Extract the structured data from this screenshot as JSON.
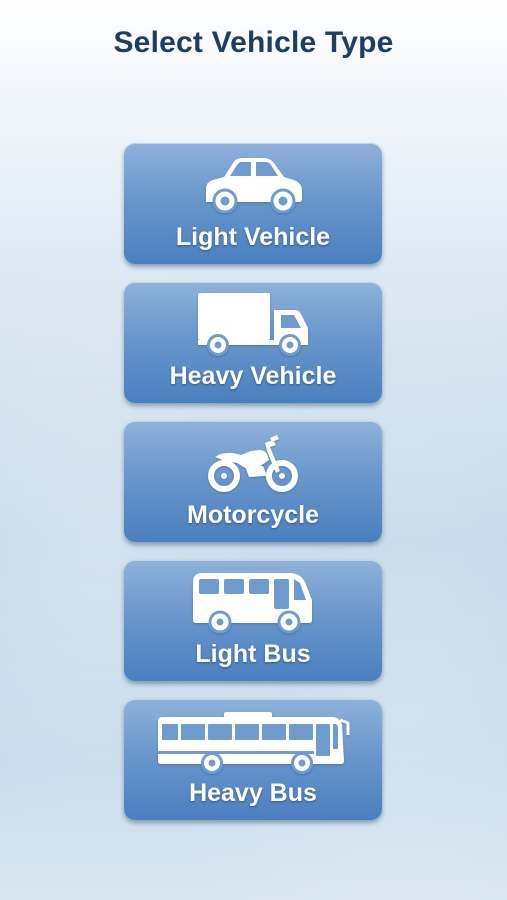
{
  "header": {
    "title": "Select Vehicle Type"
  },
  "vehicles": [
    {
      "label": "Light Vehicle",
      "icon": "car-icon"
    },
    {
      "label": "Heavy Vehicle",
      "icon": "truck-icon"
    },
    {
      "label": "Motorcycle",
      "icon": "motorcycle-icon"
    },
    {
      "label": "Light Bus",
      "icon": "minibus-icon"
    },
    {
      "label": "Heavy Bus",
      "icon": "coach-bus-icon"
    }
  ],
  "colors": {
    "title": "#1f3d63",
    "button_top": "#8fb2da",
    "button_bottom": "#4a7fbf",
    "icon_and_label": "#ffffff"
  }
}
